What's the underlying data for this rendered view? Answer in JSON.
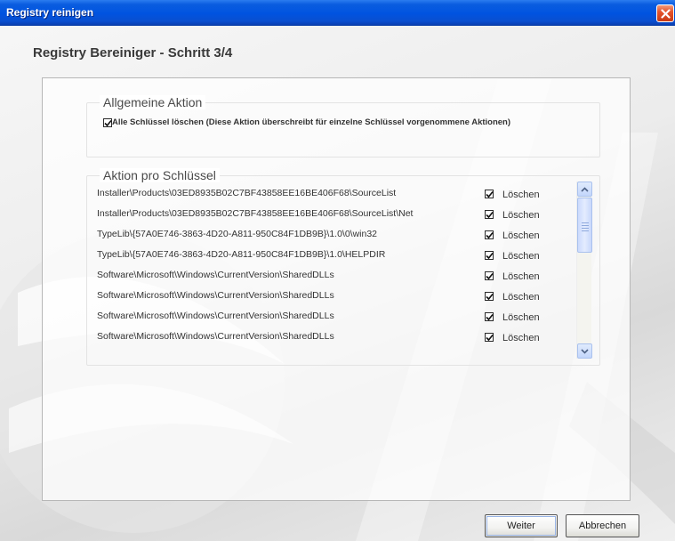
{
  "window": {
    "title": "Registry reinigen"
  },
  "heading": "Registry Bereiniger - Schritt 3/4",
  "general_action": {
    "legend": "Allgemeine Aktion",
    "delete_all_label": "Alle Schlüssel löschen (Diese Aktion überschreibt für einzelne Schlüssel vorgenommene Aktionen)",
    "delete_all_checked": true
  },
  "per_key_action": {
    "legend": "Aktion pro Schlüssel",
    "rows": [
      {
        "key": "Installer\\Products\\03ED8935B02C7BF43858EE16BE406F68\\SourceList",
        "action": "Löschen",
        "checked": true
      },
      {
        "key": "Installer\\Products\\03ED8935B02C7BF43858EE16BE406F68\\SourceList\\Net",
        "action": "Löschen",
        "checked": true
      },
      {
        "key": "TypeLib\\{57A0E746-3863-4D20-A811-950C84F1DB9B}\\1.0\\0\\win32",
        "action": "Löschen",
        "checked": true
      },
      {
        "key": "TypeLib\\{57A0E746-3863-4D20-A811-950C84F1DB9B}\\1.0\\HELPDIR",
        "action": "Löschen",
        "checked": true
      },
      {
        "key": "Software\\Microsoft\\Windows\\CurrentVersion\\SharedDLLs",
        "action": "Löschen",
        "checked": true
      },
      {
        "key": "Software\\Microsoft\\Windows\\CurrentVersion\\SharedDLLs",
        "action": "Löschen",
        "checked": true
      },
      {
        "key": "Software\\Microsoft\\Windows\\CurrentVersion\\SharedDLLs",
        "action": "Löschen",
        "checked": true
      },
      {
        "key": "Software\\Microsoft\\Windows\\CurrentVersion\\SharedDLLs",
        "action": "Löschen",
        "checked": true
      }
    ]
  },
  "buttons": {
    "next": "Weiter",
    "cancel": "Abbrechen"
  },
  "colors": {
    "titlebar": "#0053e0",
    "close": "#e5542c"
  },
  "icons": {
    "close": "close-icon",
    "scroll_up": "chevron-up-icon",
    "scroll_down": "chevron-down-icon"
  }
}
